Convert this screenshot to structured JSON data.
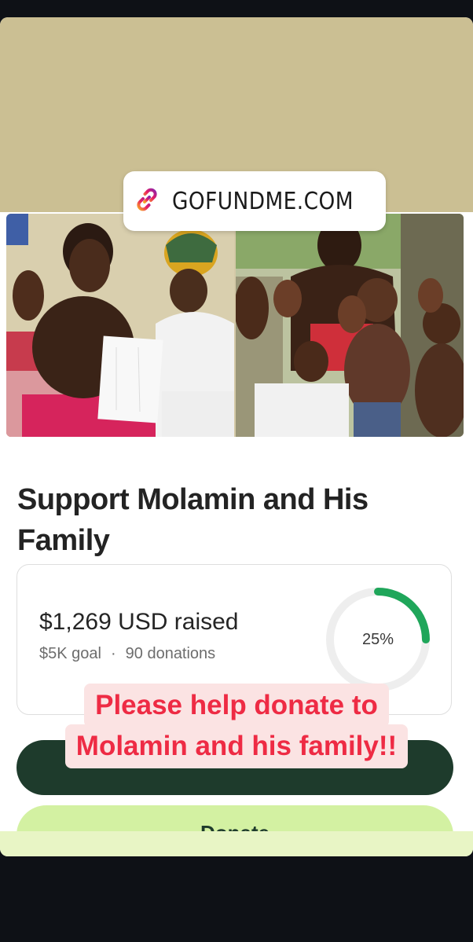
{
  "sticker": {
    "link_text": "GOFUNDME.COM",
    "icon": "link-icon"
  },
  "campaign": {
    "title": "Support Molamin and His Family",
    "raised": "$1,269 USD raised",
    "goal": "$5K goal",
    "separator": "·",
    "donations": "90 donations",
    "progress_label": "25%",
    "progress": 0.25,
    "donate_label": "Donate"
  },
  "caption": {
    "line1": "Please help donate to",
    "line2": "Molamin and his family!!"
  },
  "colors": {
    "progress": "#1fa65a",
    "caption_text": "#ee2b44",
    "caption_bg": "#fbe3e3",
    "share_button": "#1e3b2c",
    "donate_button": "#d3f1a2"
  }
}
